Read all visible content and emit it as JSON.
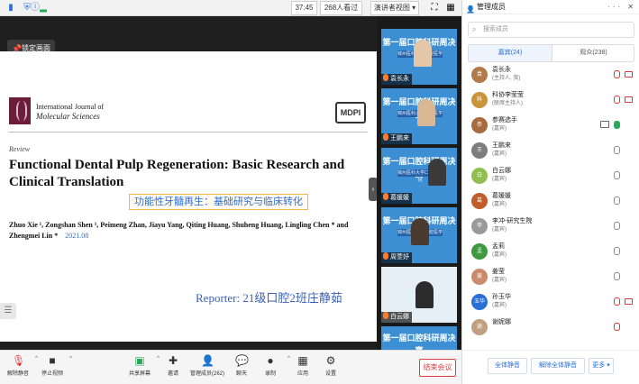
{
  "topbar": {
    "time": "37:45",
    "viewers": "268人看过",
    "view_mode": "演讲者视图 ▾",
    "icons": [
      "signal-bars-icon",
      "shield-icon",
      "info-icon",
      "signal-strength-icon",
      "fullscreen-icon",
      "grid-icon",
      "more-icon"
    ]
  },
  "stage": {
    "lock_label": "锁定画面",
    "journal_line1": "International Journal of",
    "journal_line2": "Molecular Sciences",
    "publisher": "MDPI",
    "review_label": "Review",
    "paper_title": "Functional Dental Pulp Regeneration: Basic Research and Clinical Translation",
    "cn_title": "功能性牙髓再生：基础研究与临床转化",
    "authors": "Zhuo Xie ¹, Zongshan Shen ¹, Peimeng Zhan, Jiayu Yang, Qiting Huang, Shuheng Huang, Lingling Chen * and Zhengmei Lin *",
    "year": "2021.08",
    "reporter": "Reporter: 21级口腔2班庄静茹"
  },
  "video_tiles": [
    {
      "name": "袁长永",
      "banner": "第一届口腔科研周决赛",
      "sub": "锦州医科大学口腔医学院"
    },
    {
      "name": "王鹏来",
      "banner": "第一届口腔科研周决赛",
      "sub": "锦州医科大学口腔医学院"
    },
    {
      "name": "葛媛媛",
      "banner": "第一届口腔科研周决赛",
      "sub": "锦州医科大学口腔医学院"
    },
    {
      "name": "周萱妤",
      "banner": "第一届口腔科研周决赛",
      "sub": "锦州医科大学口腔医学院"
    },
    {
      "name": "白云娜",
      "banner": "",
      "sub": ""
    },
    {
      "name": "",
      "banner": "第一届口腔科研周决赛",
      "sub": ""
    }
  ],
  "toolbar": {
    "mute": "解除静音",
    "stop_video": "停止视频",
    "share": "共享屏幕",
    "invite": "邀请",
    "members": "管理成员(262)",
    "chat": "聊天",
    "record": "录制",
    "apps": "应用",
    "settings": "设置",
    "end_meeting": "结束会议"
  },
  "panel": {
    "title": "管理成员",
    "search_placeholder": "搜索成员",
    "tab_guests": "嘉宾(24)",
    "tab_audience": "观众(238)",
    "members": [
      {
        "name": "袁长永",
        "role": "(主持人, 我)",
        "avatar": "袁",
        "color": "#b07a4a"
      },
      {
        "name": "科协李莹莹",
        "role": "(联席主持人)",
        "avatar": "科",
        "color": "#c9953c"
      },
      {
        "name": "参赛选手",
        "role": "(嘉宾)",
        "avatar": "参",
        "color": "#a86b3d"
      },
      {
        "name": "王鹏来",
        "role": "(嘉宾)",
        "avatar": "王",
        "color": "#7d7d7d"
      },
      {
        "name": "白云娜",
        "role": "(嘉宾)",
        "avatar": "白",
        "color": "#8fbf4e"
      },
      {
        "name": "葛媛媛",
        "role": "(嘉宾)",
        "avatar": "葛",
        "color": "#c05d2a"
      },
      {
        "name": "李冲-研究生院",
        "role": "(嘉宾)",
        "avatar": "李",
        "color": "#9a9a9a"
      },
      {
        "name": "孟莉",
        "role": "(嘉宾)",
        "avatar": "孟",
        "color": "#3f9a3f"
      },
      {
        "name": "姜莹",
        "role": "(嘉宾)",
        "avatar": "姜",
        "color": "#c98b6b"
      },
      {
        "name": "孙玉华",
        "role": "(嘉宾)",
        "avatar": "玉华",
        "color": "#2a6fd6"
      },
      {
        "name": "谢妮娜",
        "role": "",
        "avatar": "谢",
        "color": "#c0a080"
      }
    ],
    "mute_all": "全体静音",
    "unmute_all": "解除全体静音",
    "more": "更多 ▾"
  }
}
